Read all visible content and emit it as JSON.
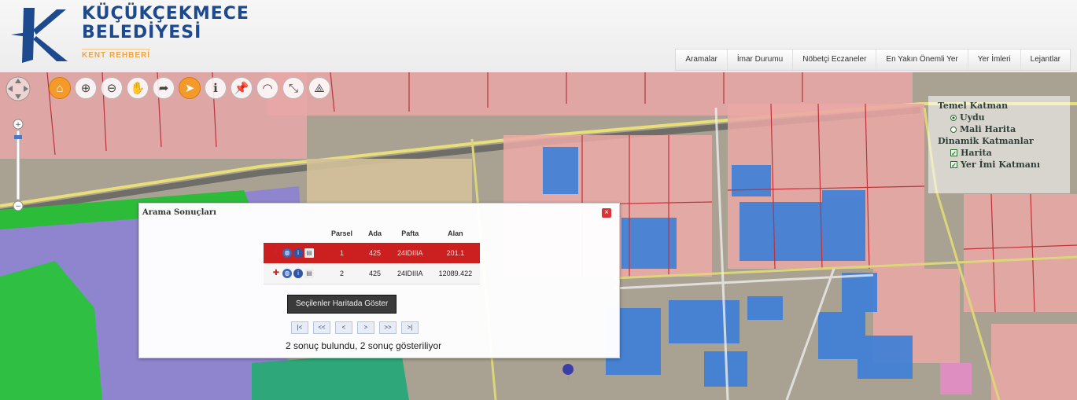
{
  "app": {
    "brand_line1": "KÜÇÜKÇEKMECE",
    "brand_line2": "BELEDİYESİ",
    "brand_sub": "KENT REHBERİ",
    "accent": "#f39a2b",
    "brand_color": "#1d4a8f"
  },
  "nav": {
    "items": [
      {
        "label": "Aramalar"
      },
      {
        "label": "İmar Durumu"
      },
      {
        "label": "Nöbetçi Eczaneler"
      },
      {
        "label": "En Yakın Önemli Yer"
      },
      {
        "label": "Yer İmleri"
      },
      {
        "label": "Lejantlar"
      }
    ]
  },
  "toolbar": {
    "tools": [
      "home-icon",
      "zoom-in-icon",
      "zoom-out-icon",
      "pan-icon",
      "back-icon",
      "select-icon",
      "info-icon",
      "pin-icon",
      "bell-icon",
      "measure-distance-icon",
      "measure-area-icon"
    ],
    "active": "select-icon"
  },
  "layers": {
    "base_title": "Temel Katman",
    "base_options": [
      {
        "label": "Uydu",
        "selected": true
      },
      {
        "label": "Mali Harita",
        "selected": false
      }
    ],
    "dynamic_title": "Dinamik Katmanlar",
    "dynamic_options": [
      {
        "label": "Harita",
        "checked": true
      },
      {
        "label": "Yer İmi Katmanı",
        "checked": true
      }
    ]
  },
  "results": {
    "title": "Arama Sonuçları",
    "columns": [
      "Parsel",
      "Ada",
      "Pafta",
      "Alan"
    ],
    "rows": [
      {
        "parsel": "1",
        "ada": "425",
        "pafta": "24IDIIIA",
        "alan": "201.1",
        "selected": true
      },
      {
        "parsel": "2",
        "ada": "425",
        "pafta": "24IDIIIA",
        "alan": "12089.422",
        "selected": false
      }
    ],
    "show_button": "Seçilenler Haritada Göster",
    "pager": [
      "|<",
      "<<",
      "<",
      ">",
      ">>",
      ">|"
    ],
    "summary": "2 sonuç bulundu, 2 sonuç gösteriliyor"
  }
}
